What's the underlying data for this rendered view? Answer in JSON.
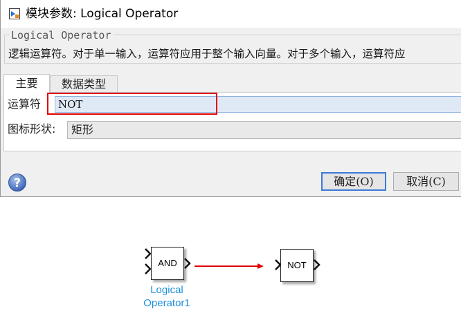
{
  "window": {
    "title": "模块参数: Logical Operator"
  },
  "group": {
    "legend": "Logical Operator",
    "description": "逻辑运算符。对于单一输入，运算符应用于整个输入向量。对于多个输入，运算符应"
  },
  "tabs": [
    {
      "label": "主要",
      "active": true
    },
    {
      "label": "数据类型",
      "active": false
    }
  ],
  "params": {
    "operator_label": "运算符",
    "operator_value": "NOT",
    "shape_label": "图标形状:",
    "shape_value": "矩形"
  },
  "buttons": {
    "ok": "确定(O)",
    "cancel": "取消(C)"
  },
  "diagram": {
    "source_block": {
      "label": "AND",
      "name_line1": "Logical",
      "name_line2": "Operator1"
    },
    "target_block": {
      "label": "NOT"
    },
    "connection_color": "#e00000",
    "highlight_color": "#e00000",
    "name_color": "#1d8fe0"
  },
  "icons": {
    "app": "simulink-block-icon",
    "help": "help-question-icon"
  }
}
